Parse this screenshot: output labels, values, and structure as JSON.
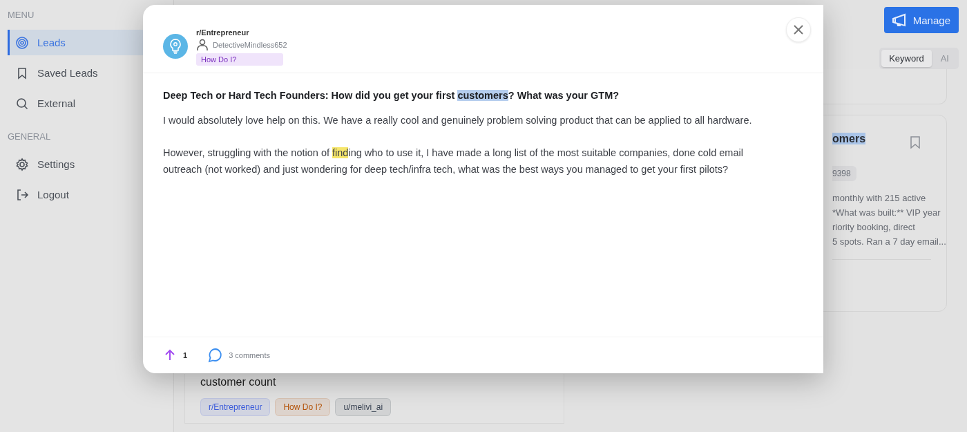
{
  "sidebar": {
    "sections": [
      {
        "heading": "MENU",
        "items": [
          {
            "label": "Leads",
            "selected": true
          },
          {
            "label": "Saved Leads",
            "selected": false
          },
          {
            "label": "External",
            "selected": false
          }
        ]
      },
      {
        "heading": "GENERAL",
        "items": [
          {
            "label": "Settings",
            "selected": false
          },
          {
            "label": "Logout",
            "selected": false
          }
        ]
      }
    ]
  },
  "header": {
    "manage_button": "Manage",
    "mode_toggle": [
      {
        "label": "Keyword",
        "selected": true
      },
      {
        "label": "AI",
        "selected": false
      }
    ]
  },
  "background_cards": {
    "right_card": {
      "title_fragment": "omers",
      "chip_fragment": "9398",
      "excerpt_lines": [
        "monthly with 215 active",
        "*What was built:** VIP year",
        "riority booking, direct",
        "5 spots. Ran a 7 day email..."
      ]
    },
    "left_card": {
      "title_fragment": "customer count",
      "tags": [
        {
          "label": "r/Entrepreneur",
          "color": "#3b5bdb"
        },
        {
          "label": "How Do I?",
          "color": "#b45309"
        },
        {
          "label": "u/melivi_ai",
          "color": "#374151"
        }
      ]
    }
  },
  "modal": {
    "subreddit": "r/Entrepreneur",
    "author": "DetectiveMindless652",
    "flair": "How Do I?",
    "title": [
      {
        "text": "Deep Tech or Hard Tech Founders: How did you get your first ",
        "kind": "plain"
      },
      {
        "text": "customers",
        "kind": "selection"
      },
      {
        "text": "? What was your GTM?",
        "kind": "plain"
      }
    ],
    "paragraphs": [
      [
        {
          "text": "I would absolutely love help on this. We have a really cool and genuinely problem solving product that can be applied to all hardware.",
          "kind": "plain"
        }
      ],
      [
        {
          "text": "However, struggling with the notion of ",
          "kind": "plain"
        },
        {
          "text": "find",
          "kind": "match"
        },
        {
          "text": "ing who to use it, I have made a long list of the most suitable companies, done cold email outreach (not worked) and just wondering for deep tech/infra tech, what was the best ways you managed to get your first pilots?",
          "kind": "plain"
        }
      ]
    ],
    "upvotes": "1",
    "comments": "3 comments"
  }
}
